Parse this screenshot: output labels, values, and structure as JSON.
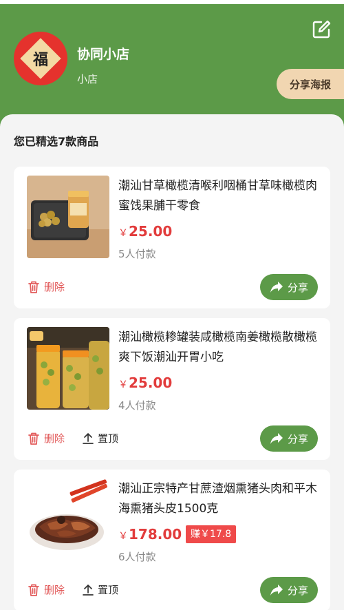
{
  "shop": {
    "avatar_char": "福",
    "name": "协同小店",
    "subtitle": "小店",
    "poster_button": "分享海报",
    "edit_icon": "edit-icon"
  },
  "list": {
    "heading": "您已精选7款商品",
    "delete_label": "删除",
    "pin_label": "置顶",
    "share_label": "分享",
    "items": [
      {
        "title": "潮汕甘草橄榄清喉利咽桶甘草味橄榄肉蜜饯果脯干零食",
        "currency": "￥",
        "price": "25.00",
        "sold": "5人付款"
      },
      {
        "title": "潮汕橄榄糁罐装咸橄榄南姜橄榄散橄榄爽下饭潮汕开胃小吃",
        "currency": "￥",
        "price": "25.00",
        "sold": "4人付款"
      },
      {
        "title": "潮汕正宗特产甘蔗渣烟熏猪头肉和平木海熏猪头皮1500克",
        "currency": "￥",
        "price": "178.00",
        "earn": "赚￥17.8",
        "sold": "6人付款"
      }
    ]
  },
  "colors": {
    "brand_green": "#5c9a48",
    "price_red": "#e23c3c",
    "poster_bg": "#f1d6b1"
  }
}
